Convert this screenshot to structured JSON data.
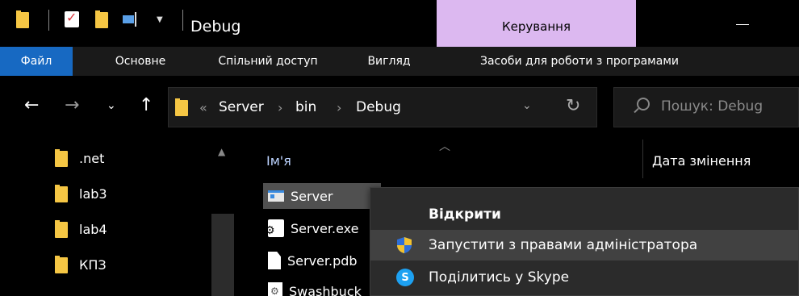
{
  "window": {
    "title": "Debug",
    "manage_tab": "Керування"
  },
  "ribbon": {
    "tabs": [
      {
        "label": "Файл"
      },
      {
        "label": "Основне"
      },
      {
        "label": "Спільний доступ"
      },
      {
        "label": "Вигляд"
      },
      {
        "label": "Засоби для роботи з програмами"
      }
    ]
  },
  "address": {
    "overflow": "«",
    "crumbs": [
      "Server",
      "bin",
      "Debug"
    ],
    "sep": "›"
  },
  "search": {
    "placeholder": "Пошук: Debug"
  },
  "navpane": {
    "items": [
      {
        "label": ".net",
        "icon": "folder-icon"
      },
      {
        "label": "lab3",
        "icon": "folder-icon"
      },
      {
        "label": "lab4",
        "icon": "folder-icon"
      },
      {
        "label": "КПЗ",
        "icon": "folder-icon"
      }
    ]
  },
  "filelist": {
    "columns": {
      "name": "Ім'я",
      "date": "Дата змінення"
    },
    "files": [
      {
        "label": "Server",
        "icon": "application-icon"
      },
      {
        "label": "Server.exe",
        "icon": "config-file-icon"
      },
      {
        "label": "Server.pdb",
        "icon": "document-icon"
      },
      {
        "label": "Swashbuck",
        "icon": "dll-file-icon"
      }
    ]
  },
  "context_menu": {
    "items": [
      {
        "label": "Відкрити"
      },
      {
        "label": "Запустити з правами адміністратора",
        "icon": "uac-shield-icon"
      },
      {
        "label": "Поділитись у Skype",
        "icon": "skype-icon"
      }
    ],
    "skype_glyph": "S"
  },
  "colors": {
    "accent": "#1769c2",
    "manage_tab": "#dcb8f0",
    "selection": "#505050",
    "menu_bg": "#2b2b2b",
    "menu_hover": "#414141"
  }
}
